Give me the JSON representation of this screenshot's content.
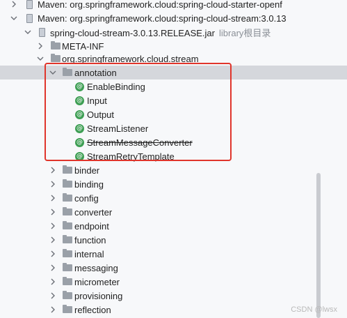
{
  "tree": {
    "maven_starter": "Maven: org.springframework.cloud:spring-cloud-starter-openf",
    "maven_stream": "Maven: org.springframework.cloud:spring-cloud-stream:3.0.13",
    "jar_name": "spring-cloud-stream-3.0.13.RELEASE.jar",
    "jar_suffix": "library根目录",
    "meta_inf": "META-INF",
    "package": "org.springframework.cloud.stream",
    "annotation_folder": "annotation",
    "annotation_classes": [
      "EnableBinding",
      "Input",
      "Output",
      "StreamListener",
      "StreamMessageConverter",
      "StreamRetryTemplate"
    ],
    "deprecated_class": "StreamMessageConverter",
    "folders": [
      "binder",
      "binding",
      "config",
      "converter",
      "endpoint",
      "function",
      "internal",
      "messaging",
      "micrometer",
      "provisioning",
      "reflection"
    ]
  },
  "icons": {
    "annotation_badge": "@",
    "chevron_expanded": "chevron-down-icon",
    "chevron_collapsed": "chevron-right-icon",
    "folder": "folder-icon",
    "jar": "jar-icon"
  },
  "colors": {
    "selection": "#d5d7dc",
    "highlight_box": "#e0352b",
    "annotation_icon": "#3d9e53"
  },
  "watermark": "CSDN @lwsx"
}
